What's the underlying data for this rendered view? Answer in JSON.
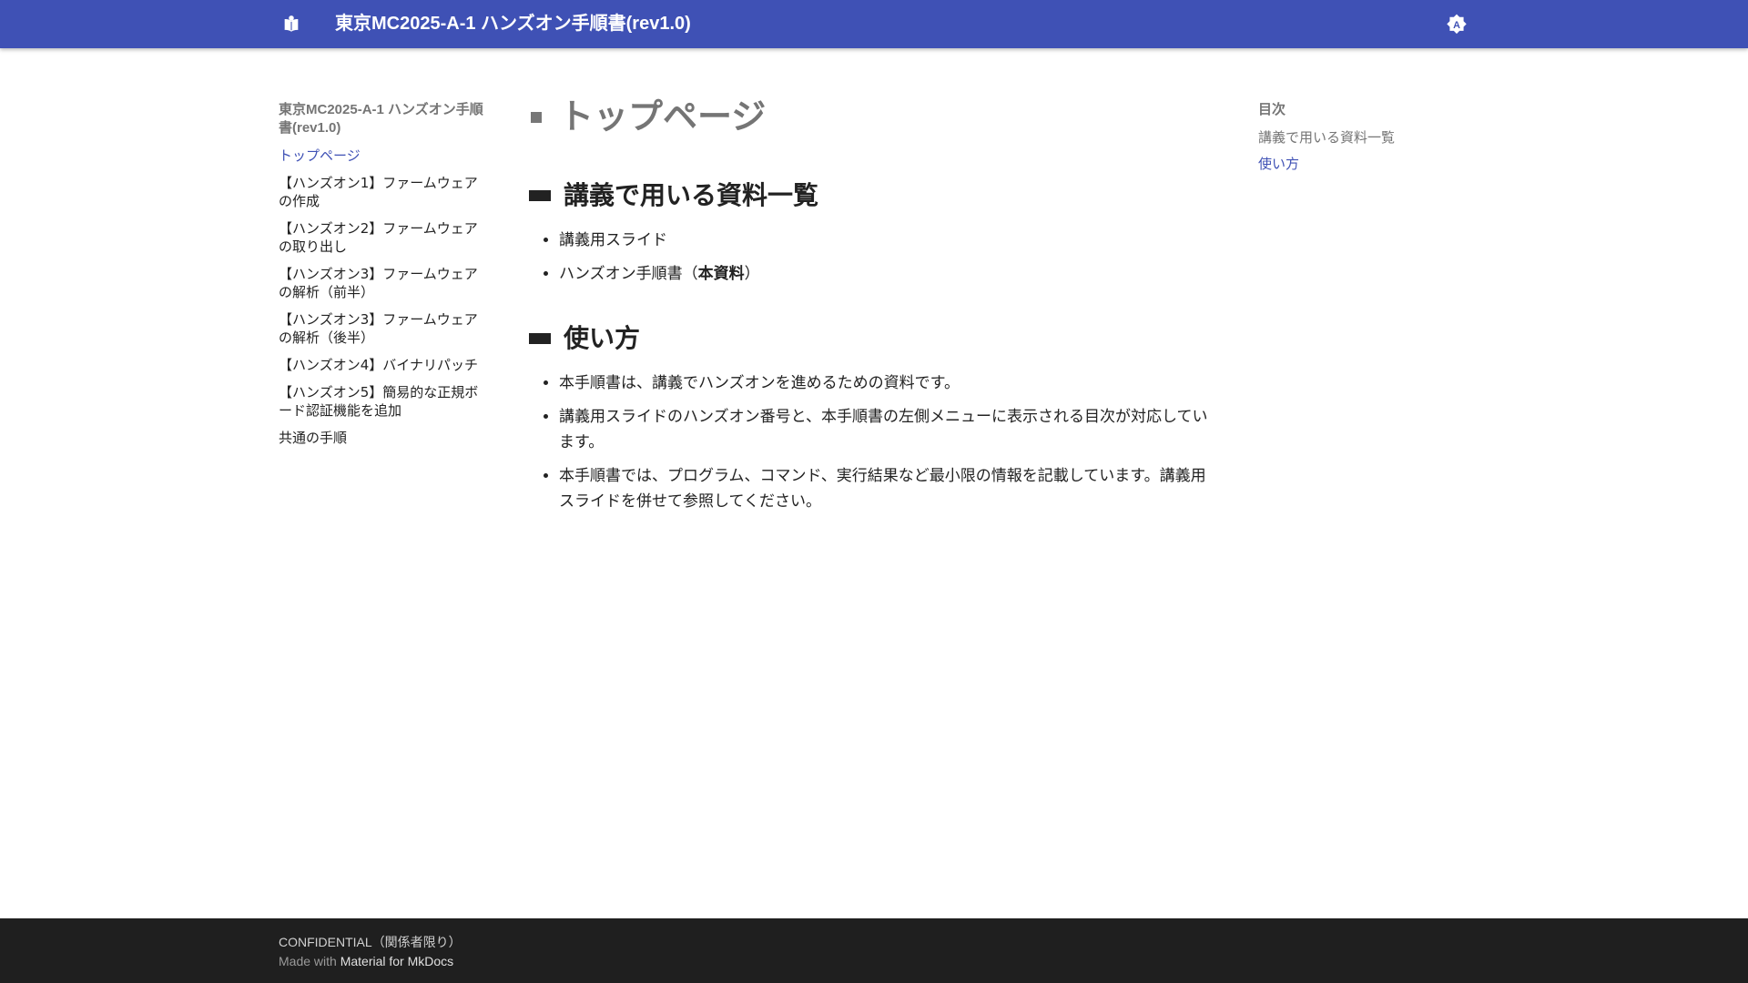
{
  "colors": {
    "header_bg": "#3f51b5",
    "link_active": "#3f51b5",
    "footer_bg": "#1f1f1f"
  },
  "header": {
    "logo_icon": "book-open-icon",
    "title": "東京MC2025-A-1 ハンズオン手順書(rev1.0)",
    "theme_toggle_icon": "brightness-auto-icon"
  },
  "nav": {
    "title": "東京MC2025-A-1 ハンズオン手順書(rev1.0)",
    "items": [
      {
        "label": "トップページ",
        "active": true
      },
      {
        "label": "【ハンズオン1】ファームウェアの作成",
        "active": false
      },
      {
        "label": "【ハンズオン2】ファームウェアの取り出し",
        "active": false
      },
      {
        "label": "【ハンズオン3】ファームウェアの解析（前半）",
        "active": false
      },
      {
        "label": "【ハンズオン3】ファームウェアの解析（後半）",
        "active": false
      },
      {
        "label": "【ハンズオン4】バイナリパッチ",
        "active": false
      },
      {
        "label": "【ハンズオン5】簡易的な正規ボード認証機能を追加",
        "active": false
      },
      {
        "label": "共通の手順",
        "active": false
      }
    ]
  },
  "main": {
    "h1": "トップページ",
    "sections": [
      {
        "heading": "講義で用いる資料一覧",
        "items": [
          {
            "text": "講義用スライド"
          },
          {
            "before": "ハンズオン手順書（",
            "bold": "本資料",
            "after": "）"
          }
        ]
      },
      {
        "heading": "使い方",
        "items": [
          {
            "text": "本手順書は、講義でハンズオンを進めるための資料です。"
          },
          {
            "text": "講義用スライドのハンズオン番号と、本手順書の左側メニューに表示される目次が対応しています。"
          },
          {
            "text": "本手順書では、プログラム、コマンド、実行結果など最小限の情報を記載しています。講義用スライドを併せて参照してください。"
          }
        ]
      }
    ]
  },
  "toc": {
    "title": "目次",
    "items": [
      {
        "label": "講義で用いる資料一覧",
        "active": false
      },
      {
        "label": "使い方",
        "active": true
      }
    ]
  },
  "footer": {
    "line1": "CONFIDENTIAL（関係者限り）",
    "made_with": "Made with",
    "link": "Material for MkDocs"
  }
}
